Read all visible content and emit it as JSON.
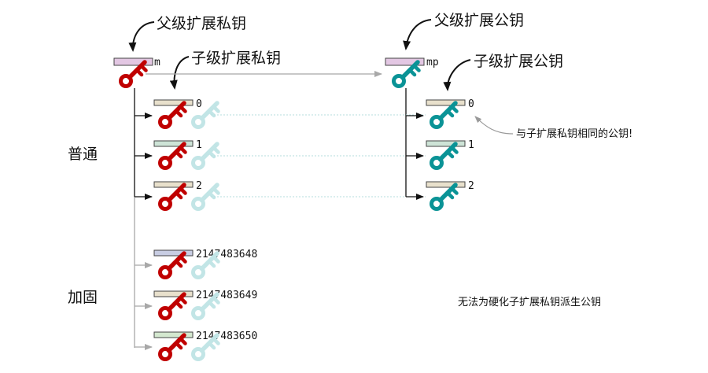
{
  "labels": {
    "parent_private": "父级扩展私钥",
    "parent_public": "父级扩展公钥",
    "child_private": "子级扩展私钥",
    "child_public": "子级扩展公钥",
    "normal": "普通",
    "hardened": "加固",
    "same_pubkey_note": "与子扩展私钥相同的公钥!",
    "no_hardened_note": "无法为硬化子扩展私钥派生公钥"
  },
  "parent": {
    "private_tag": "m",
    "public_tag": "mp"
  },
  "normal_indices": [
    "0",
    "1",
    "2"
  ],
  "hardened_indices": [
    "2147483648",
    "2147483649",
    "2147483650"
  ],
  "colors": {
    "private_key": "#c00000",
    "public_key": "#0a9396",
    "public_key_faded": "#c2e5e6",
    "parent_bar": "#e3c7e3",
    "index_bar_beige": "#e8e0cc",
    "index_bar_mint": "#cde3d6",
    "index_bar_lavender": "#c8cde3",
    "index_bar_green": "#d4e8cf"
  },
  "icons": {
    "private": "key-icon",
    "public": "key-icon"
  }
}
